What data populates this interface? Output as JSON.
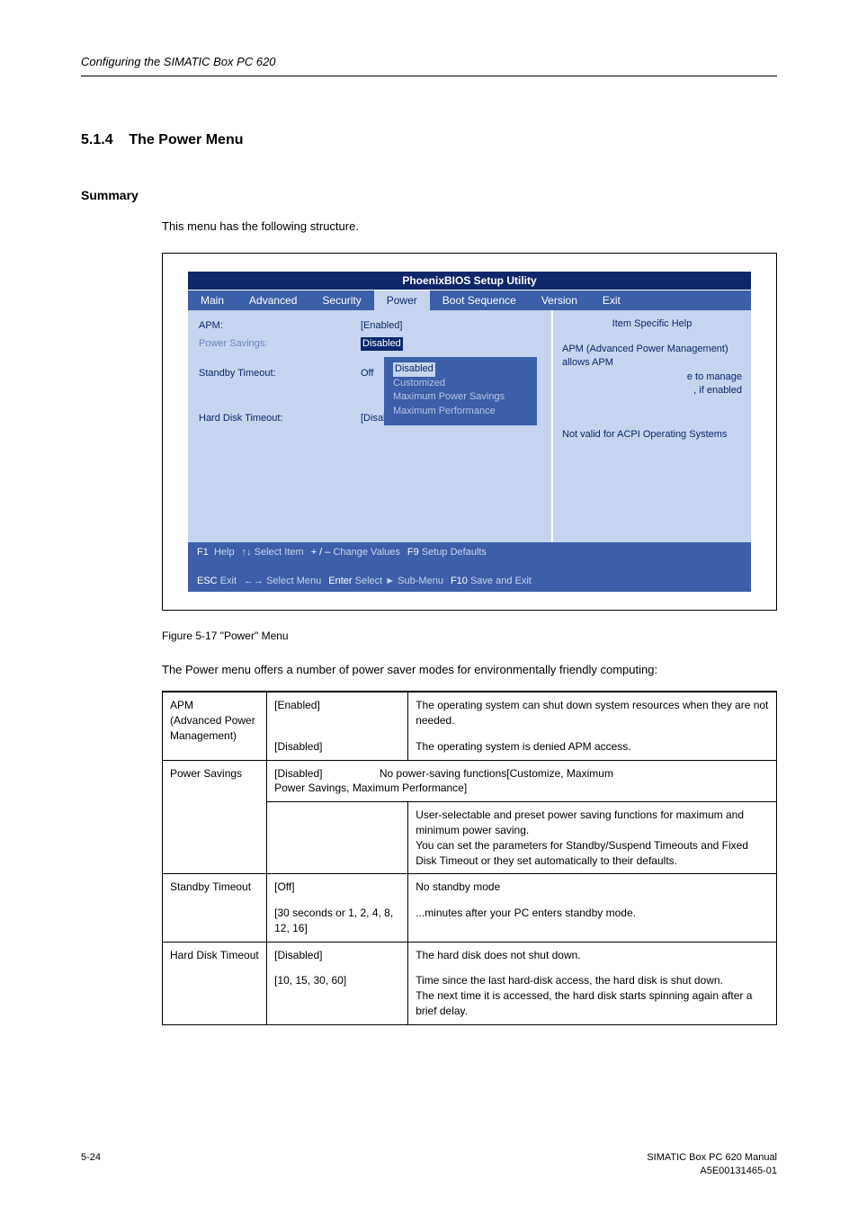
{
  "running_head": "Configuring the SIMATIC Box PC 620",
  "section_number": "5.1.4",
  "section_title": "The Power Menu",
  "summary_heading": "Summary",
  "intro_line": "This menu has the following structure.",
  "bios": {
    "title": "PhoenixBIOS Setup Utility",
    "tabs": [
      "Main",
      "Advanced",
      "Security",
      "Power",
      "Boot Sequence",
      "Version",
      "Exit"
    ],
    "fields": {
      "apm_label": "APM:",
      "apm_value": "[Enabled]",
      "power_savings_label": "Power Savings:",
      "power_savings_value": "Disabled",
      "standby_timeout_label": "Standby Timeout:",
      "standby_timeout_value": "Off",
      "hard_disk_timeout_label": "Hard Disk Timeout:",
      "hard_disk_timeout_value": "[Disabled]"
    },
    "popup": {
      "opt1": "Disabled",
      "opt2": "Customized",
      "opt3": "Maximum Power Savings",
      "opt4": "Maximum Performance"
    },
    "help": {
      "title": "Item Specific Help",
      "line1": "APM (Advanced Power Management) allows APM",
      "line2a": "e to manage",
      "line2b": ", if enabled",
      "line3": "Not valid for ACPI Operating Systems"
    },
    "footer": {
      "f1": "F1",
      "help": "Help",
      "esc": "ESC",
      "exit": "Exit",
      "select_item": "Select Item",
      "select_menu": "Select Menu",
      "change_values": "Change Values",
      "plusminus": "+ / –",
      "enter": "Enter",
      "select_sub": "Select ► Sub-Menu",
      "f9": "F9",
      "setup_defaults": "Setup Defaults",
      "f10": "F10",
      "save_exit": "Save and Exit"
    }
  },
  "figure_caption": "Figure 5-17   \"Power\" Menu",
  "para_after_figure": "The Power menu offers a number of power saver modes for environmentally friendly computing:",
  "table": {
    "r1": {
      "c1a": "APM",
      "c1b": "(Advanced Power Management)",
      "c2a": "[Enabled]",
      "c2b": "[Disabled]",
      "c3a": "The operating system can shut down system resources when they are not needed.",
      "c3b": "The operating system is denied APM access."
    },
    "r2": {
      "c1": "Power Savings",
      "c2": "[Disabled]",
      "c3a": "No power-saving functions[Customize, Maximum",
      "c3_span": "Power Savings, Maximum Performance]",
      "c3b": "User-selectable and preset power saving functions for maximum and minimum power saving.\nYou can set the parameters for Standby/Suspend Timeouts and Fixed Disk Timeout  or they set automatically to their defaults."
    },
    "r3": {
      "c1": "Standby Timeout",
      "c2a": "[Off]",
      "c2b": "[30 seconds or 1, 2, 4, 8, 12, 16]",
      "c3a": "No standby mode",
      "c3b": "...minutes after your PC enters standby mode."
    },
    "r4": {
      "c1": "Hard Disk Timeout",
      "c2a": "[Disabled]",
      "c2b": "[10, 15, 30, 60]",
      "c3a": "The hard disk does not shut down.",
      "c3b": "Time since the last hard-disk access, the hard disk is shut down.\nThe next time it is accessed, the hard disk starts spinning again after a brief delay."
    }
  },
  "page_number": "5-24",
  "manual_line1": "SIMATIC Box PC 620  Manual",
  "manual_line2": "A5E00131465-01"
}
